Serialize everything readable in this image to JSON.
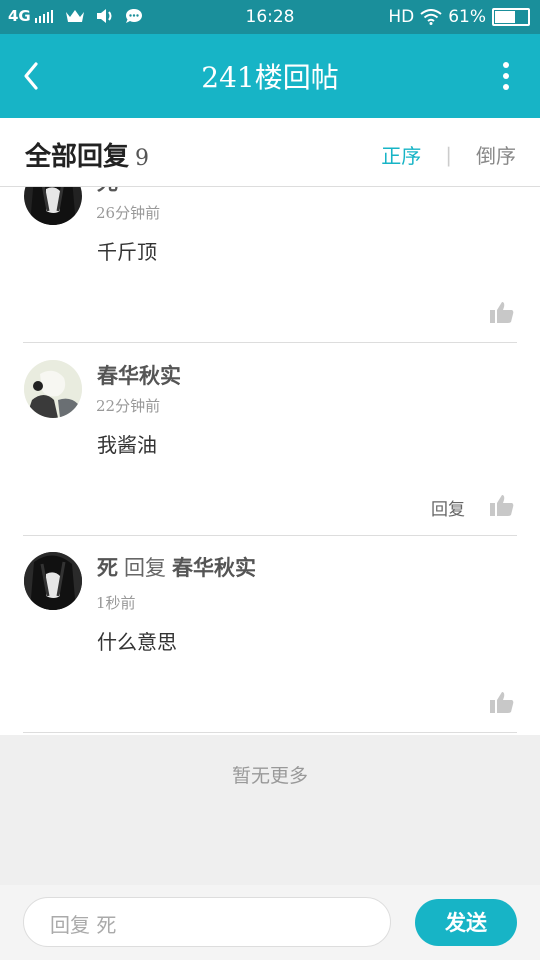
{
  "status": {
    "network": "4G",
    "time": "16:28",
    "hd": "HD",
    "battery": "61%"
  },
  "header": {
    "title": "241楼回帖"
  },
  "filter": {
    "all_label": "全部回复",
    "count": "9",
    "asc_label": "正序",
    "sep": "|",
    "desc_label": "倒序"
  },
  "replies": [
    {
      "author": "死",
      "time": "26分钟前",
      "content": "千斤顶"
    },
    {
      "author": "春华秋实",
      "time": "22分钟前",
      "content": "我酱油",
      "reply_label": "回复"
    },
    {
      "author": "死",
      "reply_word": "回复",
      "reply_to": "春华秋实",
      "time": "1秒前",
      "content": "什么意思"
    }
  ],
  "footer": {
    "no_more": "暂无更多"
  },
  "input": {
    "placeholder": "回复 死",
    "send_label": "发送"
  }
}
